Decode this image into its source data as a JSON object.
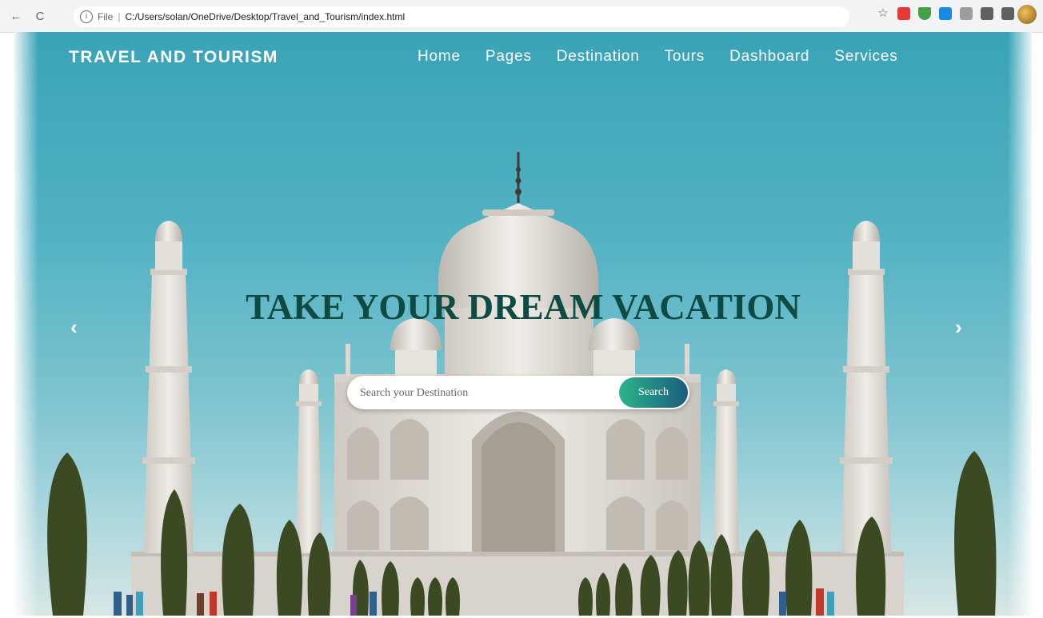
{
  "browser": {
    "back": "←",
    "forward": "→",
    "reload": "C",
    "info": "i",
    "scheme": "File",
    "url": "C:/Users/solan/OneDrive/Desktop/Travel_and_Tourism/index.html",
    "star": "☆",
    "extensions": [
      {
        "icon": "red-extension-icon",
        "color": "#e53935"
      },
      {
        "icon": "shield-extension-icon",
        "color": "#43a047"
      },
      {
        "icon": "calendar-extension-icon",
        "color": "#1e88e5"
      },
      {
        "icon": "camera-extension-icon",
        "color": "#9e9e9e"
      },
      {
        "icon": "puzzle-extension-icon",
        "color": "#616161"
      },
      {
        "icon": "playlist-extension-icon",
        "color": "#616161"
      }
    ]
  },
  "site": {
    "brand": "TRAVEL AND TOURISM",
    "nav": [
      "Home",
      "Pages",
      "Destination",
      "Tours",
      "Dashboard",
      "Services"
    ]
  },
  "hero": {
    "headline": "TAKE YOUR DREAM VACATION",
    "search_placeholder": "Search your Destination",
    "search_button": "Search",
    "prev": "‹",
    "next": "›"
  },
  "colors": {
    "headline": "#0f4b45",
    "sky": "#52b2c3",
    "button_start": "#2cb48a",
    "button_end": "#1a5d7d"
  }
}
